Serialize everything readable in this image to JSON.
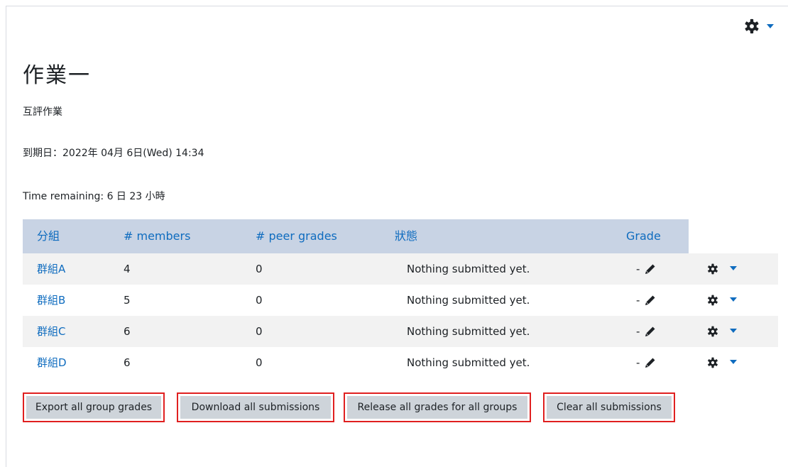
{
  "page": {
    "title": "作業一",
    "description": "互評作業",
    "due_date": "到期日：2022年 04月 6日(Wed) 14:34",
    "time_remaining": "Time remaining: 6 日 23 小時"
  },
  "table": {
    "headers": [
      "分組",
      "# members",
      "# peer grades",
      "狀態",
      "Grade"
    ],
    "rows": [
      {
        "group": "群組A",
        "members": "4",
        "peer_grades": "0",
        "status": "Nothing submitted yet.",
        "grade": "-"
      },
      {
        "group": "群組B",
        "members": "5",
        "peer_grades": "0",
        "status": "Nothing submitted yet.",
        "grade": "-"
      },
      {
        "group": "群組C",
        "members": "6",
        "peer_grades": "0",
        "status": "Nothing submitted yet.",
        "grade": "-"
      },
      {
        "group": "群組D",
        "members": "6",
        "peer_grades": "0",
        "status": "Nothing submitted yet.",
        "grade": "-"
      }
    ]
  },
  "buttons": {
    "export": "Export all group grades",
    "download": "Download all submissions",
    "release": "Release all grades for all groups",
    "clear": "Clear all submissions"
  },
  "icons": {
    "page_menu": "gear-icon",
    "page_menu_caret": "caret-down-icon",
    "edit": "pencil-icon",
    "row_menu": "gear-icon",
    "row_menu_caret": "caret-down-icon"
  },
  "colors": {
    "link": "#0f6cbf",
    "header_bg": "#c8d3e4",
    "stripe_bg": "#f2f2f2",
    "button_bg": "#ced4da",
    "highlight": "#e02020"
  }
}
